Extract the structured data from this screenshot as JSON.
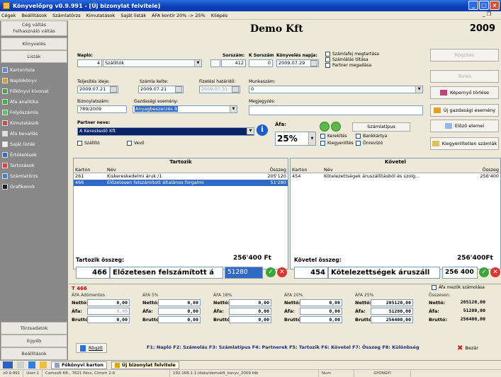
{
  "window": {
    "title": "Könyvelőprg v0.9.991 - [Új bizonylat felvitele]"
  },
  "menu": [
    "Cégek",
    "Beállítások",
    "Számlatörzs",
    "Kimutatások",
    "Saját listák",
    "ÁFA kontír 20% -> 25%",
    "Kilépés"
  ],
  "sidebar": {
    "top_buttons": [
      "Cég váltás",
      "Felhasználó váltás",
      "Könyvelés",
      "Listák"
    ],
    "items": [
      "Kartonlista",
      "Naplókönyv",
      "Főkönyvi kivonat",
      "Áfa analitika",
      "Folyószámla",
      "Kimutatások",
      "Áfa bevallás",
      "Saját listák",
      "Értékelések",
      "Tartozások",
      "Számlatörzs",
      "Grafikonok"
    ],
    "bottom_buttons": [
      "Törzsadatok",
      "Egyéb",
      "Beállítások"
    ]
  },
  "header": {
    "company": "Demo Kft",
    "year": "2009"
  },
  "form": {
    "naplo_label": "Napló:",
    "naplo_num": "4",
    "naplo_name": "Szállítók",
    "sorszam_label": "Sorszám:",
    "sorszam": "412",
    "ksorszam_label": "K Sorszám",
    "ksorszam": "0",
    "konyv_date_label": "Könyvelés napja:",
    "konyv_date": "2009.07.29",
    "chk_szamlafej": "Számlafej megtartása",
    "chk_szamlalas": "Számlálás tiltása",
    "chk_partner": "Partner megadása",
    "teljesites_label": "Teljesítés ideje:",
    "teljesites": "2009.07.21",
    "szamla_kelte_label": "Számla kelte:",
    "szamla_kelte": "2009.07.21",
    "fizetesi_label": "Fizetési határidő:",
    "fizetesi": "2009.07.31",
    "munkaszam_label": "Munkaszám:",
    "munkaszam": "0",
    "bizonylat_label": "Bizonylatszám:",
    "bizonylat": "789/2009",
    "gazd_label": "Gazdasági esemény:",
    "gazd": "Anyagbeszerzés B",
    "megjegyzes_label": "Megjegyzés:",
    "partner_label": "Partner neve:",
    "partner": "A Kereskedő Kft",
    "chk_szallito": "Szállító",
    "chk_vevo": "Vevő",
    "afa_label": "Áfa:",
    "afa": "25%",
    "szamlatipus": "Számlatípus",
    "chk_kerekites": "Kerekítés",
    "chk_bankkartya": "Bankkártya",
    "chk_kiegyenlites": "Kiegyenlítés",
    "chk_onrevizio": "Önrevízió"
  },
  "right_buttons": [
    "Rögzítés",
    "Törlés",
    "Képernyő törlése",
    "Új gazdasági esemény",
    "Előző elemei",
    "Kiegyenlítetlen számlák"
  ],
  "tartozik": {
    "title": "Tartozik",
    "headers": [
      "Karton",
      "Név",
      "Összeg"
    ],
    "rows": [
      {
        "karton": "261",
        "nev": "Kiskereskedelmi áruk /1",
        "osszeg": "205'120"
      },
      {
        "karton": "466",
        "nev": "Előzetesen felszámított általános forgalmi",
        "osszeg": "51'280"
      }
    ],
    "sum_label": "Tartozik összeg:",
    "sum": "256'400 Ft",
    "entry_karton": "466",
    "entry_nev": "Előzetesen felszámított á",
    "entry_val": "51280"
  },
  "kovetel": {
    "title": "Követel",
    "headers": [
      "Karton",
      "Név",
      "Összeg"
    ],
    "rows": [
      {
        "karton": "454",
        "nev": "Kötelezettségek áruszállításból és szolg...",
        "osszeg": "256'400"
      }
    ],
    "sum_label": "Követel összeg:",
    "sum": "256'400Ft",
    "entry_karton": "454",
    "entry_nev": "Kötelezettségek áruszáll",
    "entry_val": "256 400"
  },
  "vat": {
    "title": "T 466",
    "chk_mezok": "Áfa mezők számolása",
    "labels": {
      "netto": "Nettó:",
      "afa": "Áfa:",
      "brutto": "Bruttó:"
    },
    "cols": [
      {
        "name": "ÁFA Adómentes",
        "netto": "0,00",
        "afa": "0,00",
        "brutto": "0,00",
        "afa_gray": true
      },
      {
        "name": "ÁFA 5%",
        "netto": "0,00",
        "afa": "0,00",
        "brutto": "0,00"
      },
      {
        "name": "ÁFA 18%",
        "netto": "0,00",
        "afa": "0,00",
        "brutto": "0,00"
      },
      {
        "name": "ÁFA 20%",
        "netto": "0,00",
        "afa": "0,00",
        "brutto": "0,00"
      },
      {
        "name": "ÁFA 25%",
        "netto": "205120,00",
        "afa": "51280,00",
        "brutto": "256400,00"
      },
      {
        "name": "Összesen:",
        "netto": "205120,00",
        "afa": "51280,00",
        "brutto": "256400,00"
      }
    ]
  },
  "footer": {
    "rogzit": "Rögzít",
    "fkeys": "F1: Napló  F2: Számolás  F3: Számlatípus  F4: Partnerek  F5: Tartozik  F6: Követel  F7: Összeg  F8: Különbség",
    "bezar": "Bezár"
  },
  "taskbar": [
    "Főkönyvi karton",
    "Új bizonylat felvitele"
  ],
  "status": [
    "v0.9.991",
    "User:1",
    "Camsoft Kft., 7621 Pécs, Citrom 2-6",
    "192.168.1.1:/data/demokft_konyv_2009.fdb",
    "Num",
    "GYONGYI"
  ]
}
